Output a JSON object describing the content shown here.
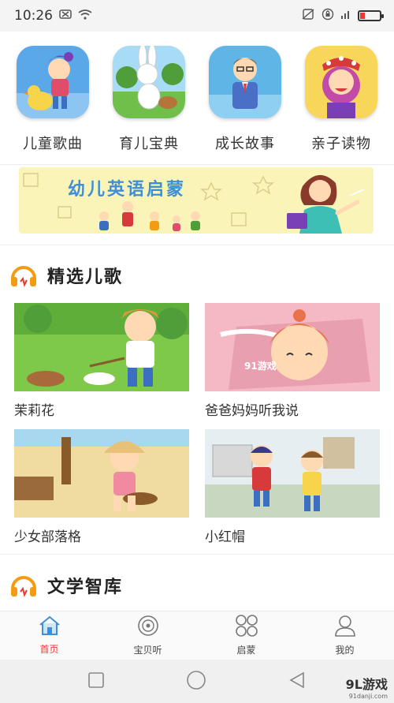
{
  "status_bar": {
    "time": "10:26"
  },
  "categories": [
    {
      "label": "儿童歌曲"
    },
    {
      "label": "育儿宝典"
    },
    {
      "label": "成长故事"
    },
    {
      "label": "亲子读物"
    }
  ],
  "banner": {
    "title": "幼儿英语启蒙"
  },
  "sections": [
    {
      "title": "精选儿歌",
      "videos": [
        {
          "title": "茉莉花"
        },
        {
          "title": "爸爸妈妈听我说"
        },
        {
          "title": "少女部落格"
        },
        {
          "title": "小红帽"
        }
      ]
    },
    {
      "title": "文学智库"
    }
  ],
  "bottom_nav": [
    {
      "label": "首页",
      "icon": "home-icon",
      "active": true
    },
    {
      "label": "宝贝听",
      "icon": "disc-icon",
      "active": false
    },
    {
      "label": "启蒙",
      "icon": "grid-icon",
      "active": false
    },
    {
      "label": "我的",
      "icon": "user-icon",
      "active": false
    }
  ],
  "watermark": {
    "logo": "9L游戏",
    "url": "91danji.com"
  },
  "colors": {
    "accent": "#e53935",
    "nav_blue": "#3d8fd6",
    "banner_bg": "#fbf4b8",
    "headphone_orange": "#f39c12"
  }
}
